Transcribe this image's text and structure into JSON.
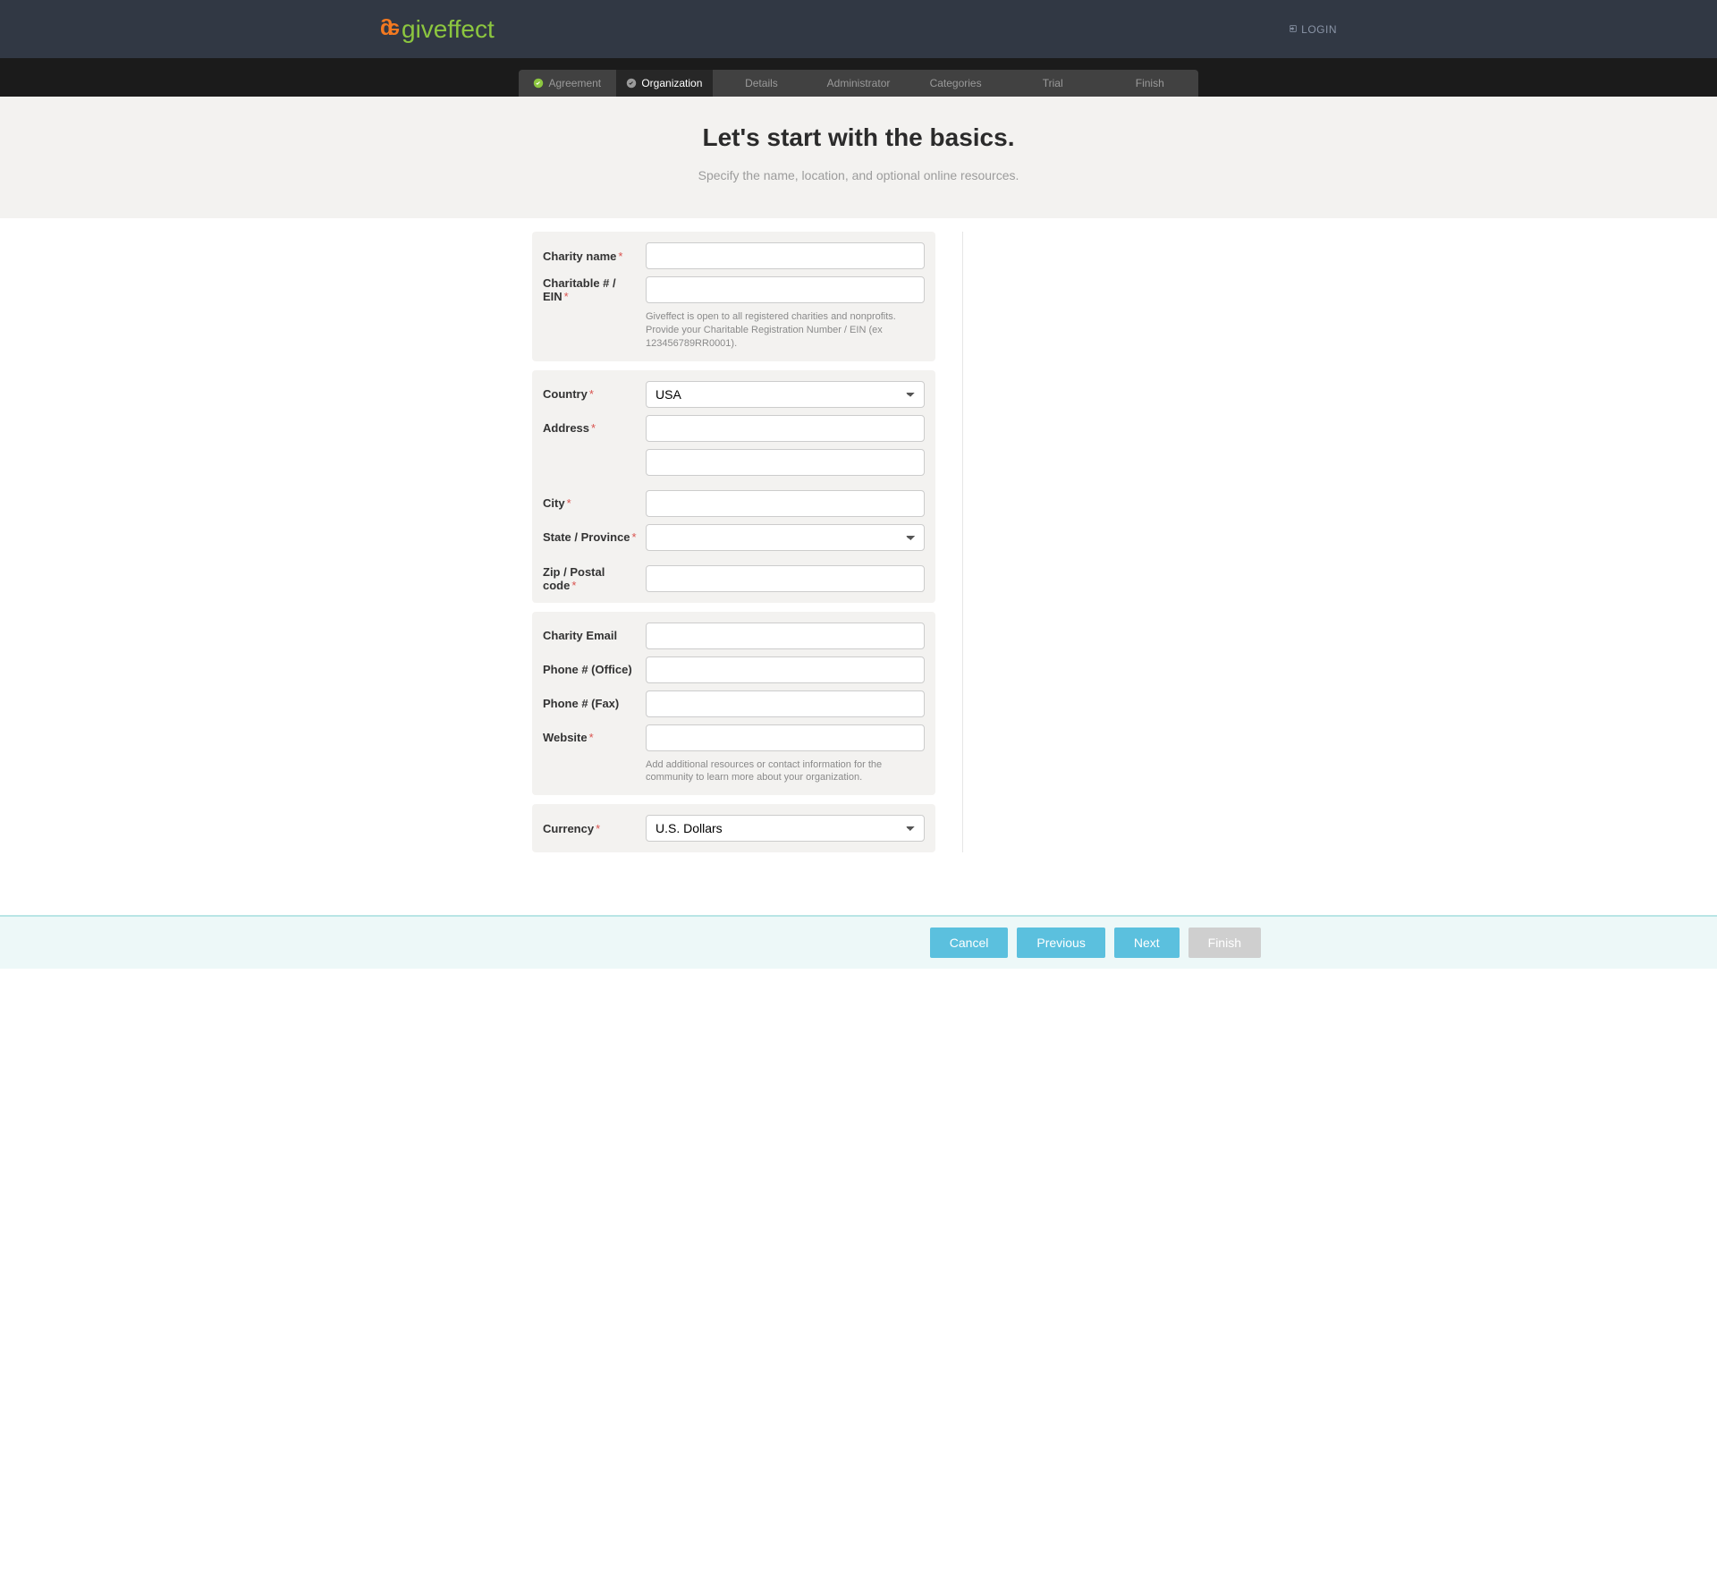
{
  "header": {
    "brand": "giveffect",
    "login": "LOGIN"
  },
  "wizard": {
    "steps": [
      {
        "label": "Agreement",
        "status": "done"
      },
      {
        "label": "Organization",
        "status": "active"
      },
      {
        "label": "Details",
        "status": "pending"
      },
      {
        "label": "Administrator",
        "status": "pending"
      },
      {
        "label": "Categories",
        "status": "pending"
      },
      {
        "label": "Trial",
        "status": "pending"
      },
      {
        "label": "Finish",
        "status": "pending"
      }
    ]
  },
  "hero": {
    "title": "Let's start with the basics.",
    "subtitle": "Specify the name, location, and optional online resources."
  },
  "form": {
    "panel1": {
      "charity_name_label": "Charity name",
      "ein_label": "Charitable # / EIN",
      "ein_help": "Giveffect is open to all registered charities and nonprofits. Provide your Charitable Registration Number / EIN (ex 123456789RR0001)."
    },
    "panel2": {
      "country_label": "Country",
      "country_value": "USA",
      "address_label": "Address",
      "city_label": "City",
      "state_label": "State / Province",
      "zip_label": "Zip / Postal code"
    },
    "panel3": {
      "email_label": "Charity Email",
      "phone_office_label": "Phone # (Office)",
      "phone_fax_label": "Phone # (Fax)",
      "website_label": "Website",
      "website_help": "Add additional resources or contact information for the community to learn more about your organization."
    },
    "panel4": {
      "currency_label": "Currency",
      "currency_value": "U.S. Dollars"
    }
  },
  "footer": {
    "cancel": "Cancel",
    "previous": "Previous",
    "next": "Next",
    "finish": "Finish"
  }
}
